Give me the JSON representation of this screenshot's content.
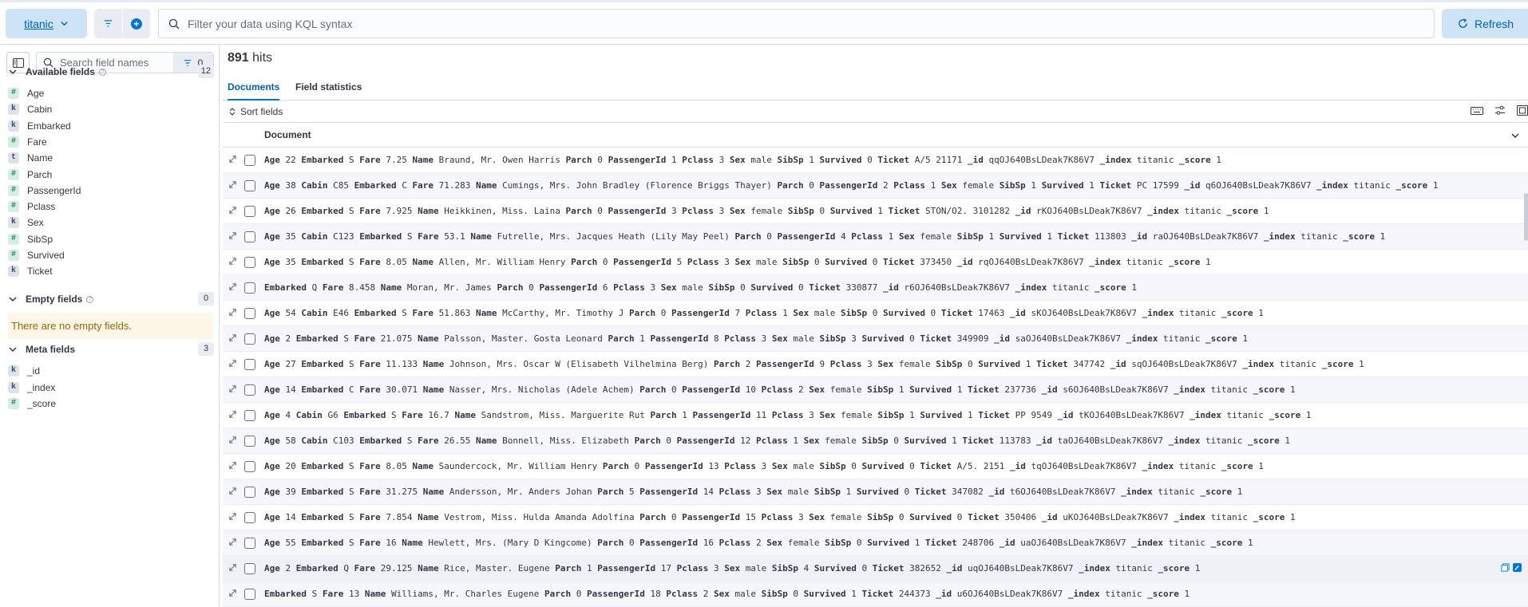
{
  "topbar": {
    "data_view": "titanic",
    "search_placeholder": "Filter your data using KQL syntax",
    "refresh_label": "Refresh"
  },
  "sidebar": {
    "search_placeholder": "Search field names",
    "filter_count": "0",
    "available": {
      "title": "Available fields",
      "count": "12",
      "fields": [
        {
          "name": "Age",
          "type": "#"
        },
        {
          "name": "Cabin",
          "type": "k"
        },
        {
          "name": "Embarked",
          "type": "k"
        },
        {
          "name": "Fare",
          "type": "#"
        },
        {
          "name": "Name",
          "type": "t"
        },
        {
          "name": "Parch",
          "type": "#"
        },
        {
          "name": "PassengerId",
          "type": "#"
        },
        {
          "name": "Pclass",
          "type": "#"
        },
        {
          "name": "Sex",
          "type": "k"
        },
        {
          "name": "SibSp",
          "type": "#"
        },
        {
          "name": "Survived",
          "type": "#"
        },
        {
          "name": "Ticket",
          "type": "k"
        }
      ]
    },
    "empty": {
      "title": "Empty fields",
      "count": "0",
      "message": "There are no empty fields."
    },
    "meta": {
      "title": "Meta fields",
      "count": "3",
      "fields": [
        {
          "name": "_id",
          "type": "k"
        },
        {
          "name": "_index",
          "type": "k"
        },
        {
          "name": "_score",
          "type": "#"
        }
      ]
    }
  },
  "main": {
    "hits_count": "891",
    "hits_label": "hits",
    "tabs": [
      "Documents",
      "Field statistics"
    ],
    "sort_label": "Sort fields",
    "column_header": "Document",
    "rows": [
      [
        [
          "Age",
          "22"
        ],
        [
          "Embarked",
          "S"
        ],
        [
          "Fare",
          "7.25"
        ],
        [
          "Name",
          "Braund, Mr. Owen Harris"
        ],
        [
          "Parch",
          "0"
        ],
        [
          "PassengerId",
          "1"
        ],
        [
          "Pclass",
          "3"
        ],
        [
          "Sex",
          "male"
        ],
        [
          "SibSp",
          "1"
        ],
        [
          "Survived",
          "0"
        ],
        [
          "Ticket",
          "A/5 21171"
        ],
        [
          "_id",
          "qqOJ640BsLDeak7K86V7"
        ],
        [
          "_index",
          "titanic"
        ],
        [
          "_score",
          "1"
        ]
      ],
      [
        [
          "Age",
          "38"
        ],
        [
          "Cabin",
          "C85"
        ],
        [
          "Embarked",
          "C"
        ],
        [
          "Fare",
          "71.283"
        ],
        [
          "Name",
          "Cumings, Mrs. John Bradley (Florence Briggs Thayer)"
        ],
        [
          "Parch",
          "0"
        ],
        [
          "PassengerId",
          "2"
        ],
        [
          "Pclass",
          "1"
        ],
        [
          "Sex",
          "female"
        ],
        [
          "SibSp",
          "1"
        ],
        [
          "Survived",
          "1"
        ],
        [
          "Ticket",
          "PC 17599"
        ],
        [
          "_id",
          "q6OJ640BsLDeak7K86V7"
        ],
        [
          "_index",
          "titanic"
        ],
        [
          "_score",
          "1"
        ]
      ],
      [
        [
          "Age",
          "26"
        ],
        [
          "Embarked",
          "S"
        ],
        [
          "Fare",
          "7.925"
        ],
        [
          "Name",
          "Heikkinen, Miss. Laina"
        ],
        [
          "Parch",
          "0"
        ],
        [
          "PassengerId",
          "3"
        ],
        [
          "Pclass",
          "3"
        ],
        [
          "Sex",
          "female"
        ],
        [
          "SibSp",
          "0"
        ],
        [
          "Survived",
          "1"
        ],
        [
          "Ticket",
          "STON/O2. 3101282"
        ],
        [
          "_id",
          "rKOJ640BsLDeak7K86V7"
        ],
        [
          "_index",
          "titanic"
        ],
        [
          "_score",
          "1"
        ]
      ],
      [
        [
          "Age",
          "35"
        ],
        [
          "Cabin",
          "C123"
        ],
        [
          "Embarked",
          "S"
        ],
        [
          "Fare",
          "53.1"
        ],
        [
          "Name",
          "Futrelle, Mrs. Jacques Heath (Lily May Peel)"
        ],
        [
          "Parch",
          "0"
        ],
        [
          "PassengerId",
          "4"
        ],
        [
          "Pclass",
          "1"
        ],
        [
          "Sex",
          "female"
        ],
        [
          "SibSp",
          "1"
        ],
        [
          "Survived",
          "1"
        ],
        [
          "Ticket",
          "113803"
        ],
        [
          "_id",
          "raOJ640BsLDeak7K86V7"
        ],
        [
          "_index",
          "titanic"
        ],
        [
          "_score",
          "1"
        ]
      ],
      [
        [
          "Age",
          "35"
        ],
        [
          "Embarked",
          "S"
        ],
        [
          "Fare",
          "8.05"
        ],
        [
          "Name",
          "Allen, Mr. William Henry"
        ],
        [
          "Parch",
          "0"
        ],
        [
          "PassengerId",
          "5"
        ],
        [
          "Pclass",
          "3"
        ],
        [
          "Sex",
          "male"
        ],
        [
          "SibSp",
          "0"
        ],
        [
          "Survived",
          "0"
        ],
        [
          "Ticket",
          "373450"
        ],
        [
          "_id",
          "rqOJ640BsLDeak7K86V7"
        ],
        [
          "_index",
          "titanic"
        ],
        [
          "_score",
          "1"
        ]
      ],
      [
        [
          "Embarked",
          "Q"
        ],
        [
          "Fare",
          "8.458"
        ],
        [
          "Name",
          "Moran, Mr. James"
        ],
        [
          "Parch",
          "0"
        ],
        [
          "PassengerId",
          "6"
        ],
        [
          "Pclass",
          "3"
        ],
        [
          "Sex",
          "male"
        ],
        [
          "SibSp",
          "0"
        ],
        [
          "Survived",
          "0"
        ],
        [
          "Ticket",
          "330877"
        ],
        [
          "_id",
          "r6OJ640BsLDeak7K86V7"
        ],
        [
          "_index",
          "titanic"
        ],
        [
          "_score",
          "1"
        ]
      ],
      [
        [
          "Age",
          "54"
        ],
        [
          "Cabin",
          "E46"
        ],
        [
          "Embarked",
          "S"
        ],
        [
          "Fare",
          "51.863"
        ],
        [
          "Name",
          "McCarthy, Mr. Timothy J"
        ],
        [
          "Parch",
          "0"
        ],
        [
          "PassengerId",
          "7"
        ],
        [
          "Pclass",
          "1"
        ],
        [
          "Sex",
          "male"
        ],
        [
          "SibSp",
          "0"
        ],
        [
          "Survived",
          "0"
        ],
        [
          "Ticket",
          "17463"
        ],
        [
          "_id",
          "sKOJ640BsLDeak7K86V7"
        ],
        [
          "_index",
          "titanic"
        ],
        [
          "_score",
          "1"
        ]
      ],
      [
        [
          "Age",
          "2"
        ],
        [
          "Embarked",
          "S"
        ],
        [
          "Fare",
          "21.075"
        ],
        [
          "Name",
          "Palsson, Master. Gosta Leonard"
        ],
        [
          "Parch",
          "1"
        ],
        [
          "PassengerId",
          "8"
        ],
        [
          "Pclass",
          "3"
        ],
        [
          "Sex",
          "male"
        ],
        [
          "SibSp",
          "3"
        ],
        [
          "Survived",
          "0"
        ],
        [
          "Ticket",
          "349909"
        ],
        [
          "_id",
          "saOJ640BsLDeak7K86V7"
        ],
        [
          "_index",
          "titanic"
        ],
        [
          "_score",
          "1"
        ]
      ],
      [
        [
          "Age",
          "27"
        ],
        [
          "Embarked",
          "S"
        ],
        [
          "Fare",
          "11.133"
        ],
        [
          "Name",
          "Johnson, Mrs. Oscar W (Elisabeth Vilhelmina Berg)"
        ],
        [
          "Parch",
          "2"
        ],
        [
          "PassengerId",
          "9"
        ],
        [
          "Pclass",
          "3"
        ],
        [
          "Sex",
          "female"
        ],
        [
          "SibSp",
          "0"
        ],
        [
          "Survived",
          "1"
        ],
        [
          "Ticket",
          "347742"
        ],
        [
          "_id",
          "sqOJ640BsLDeak7K86V7"
        ],
        [
          "_index",
          "titanic"
        ],
        [
          "_score",
          "1"
        ]
      ],
      [
        [
          "Age",
          "14"
        ],
        [
          "Embarked",
          "C"
        ],
        [
          "Fare",
          "30.071"
        ],
        [
          "Name",
          "Nasser, Mrs. Nicholas (Adele Achem)"
        ],
        [
          "Parch",
          "0"
        ],
        [
          "PassengerId",
          "10"
        ],
        [
          "Pclass",
          "2"
        ],
        [
          "Sex",
          "female"
        ],
        [
          "SibSp",
          "1"
        ],
        [
          "Survived",
          "1"
        ],
        [
          "Ticket",
          "237736"
        ],
        [
          "_id",
          "s6OJ640BsLDeak7K86V7"
        ],
        [
          "_index",
          "titanic"
        ],
        [
          "_score",
          "1"
        ]
      ],
      [
        [
          "Age",
          "4"
        ],
        [
          "Cabin",
          "G6"
        ],
        [
          "Embarked",
          "S"
        ],
        [
          "Fare",
          "16.7"
        ],
        [
          "Name",
          "Sandstrom, Miss. Marguerite Rut"
        ],
        [
          "Parch",
          "1"
        ],
        [
          "PassengerId",
          "11"
        ],
        [
          "Pclass",
          "3"
        ],
        [
          "Sex",
          "female"
        ],
        [
          "SibSp",
          "1"
        ],
        [
          "Survived",
          "1"
        ],
        [
          "Ticket",
          "PP 9549"
        ],
        [
          "_id",
          "tKOJ640BsLDeak7K86V7"
        ],
        [
          "_index",
          "titanic"
        ],
        [
          "_score",
          "1"
        ]
      ],
      [
        [
          "Age",
          "58"
        ],
        [
          "Cabin",
          "C103"
        ],
        [
          "Embarked",
          "S"
        ],
        [
          "Fare",
          "26.55"
        ],
        [
          "Name",
          "Bonnell, Miss. Elizabeth"
        ],
        [
          "Parch",
          "0"
        ],
        [
          "PassengerId",
          "12"
        ],
        [
          "Pclass",
          "1"
        ],
        [
          "Sex",
          "female"
        ],
        [
          "SibSp",
          "0"
        ],
        [
          "Survived",
          "1"
        ],
        [
          "Ticket",
          "113783"
        ],
        [
          "_id",
          "taOJ640BsLDeak7K86V7"
        ],
        [
          "_index",
          "titanic"
        ],
        [
          "_score",
          "1"
        ]
      ],
      [
        [
          "Age",
          "20"
        ],
        [
          "Embarked",
          "S"
        ],
        [
          "Fare",
          "8.05"
        ],
        [
          "Name",
          "Saundercock, Mr. William Henry"
        ],
        [
          "Parch",
          "0"
        ],
        [
          "PassengerId",
          "13"
        ],
        [
          "Pclass",
          "3"
        ],
        [
          "Sex",
          "male"
        ],
        [
          "SibSp",
          "0"
        ],
        [
          "Survived",
          "0"
        ],
        [
          "Ticket",
          "A/5. 2151"
        ],
        [
          "_id",
          "tqOJ640BsLDeak7K86V7"
        ],
        [
          "_index",
          "titanic"
        ],
        [
          "_score",
          "1"
        ]
      ],
      [
        [
          "Age",
          "39"
        ],
        [
          "Embarked",
          "S"
        ],
        [
          "Fare",
          "31.275"
        ],
        [
          "Name",
          "Andersson, Mr. Anders Johan"
        ],
        [
          "Parch",
          "5"
        ],
        [
          "PassengerId",
          "14"
        ],
        [
          "Pclass",
          "3"
        ],
        [
          "Sex",
          "male"
        ],
        [
          "SibSp",
          "1"
        ],
        [
          "Survived",
          "0"
        ],
        [
          "Ticket",
          "347082"
        ],
        [
          "_id",
          "t6OJ640BsLDeak7K86V7"
        ],
        [
          "_index",
          "titanic"
        ],
        [
          "_score",
          "1"
        ]
      ],
      [
        [
          "Age",
          "14"
        ],
        [
          "Embarked",
          "S"
        ],
        [
          "Fare",
          "7.854"
        ],
        [
          "Name",
          "Vestrom, Miss. Hulda Amanda Adolfina"
        ],
        [
          "Parch",
          "0"
        ],
        [
          "PassengerId",
          "15"
        ],
        [
          "Pclass",
          "3"
        ],
        [
          "Sex",
          "female"
        ],
        [
          "SibSp",
          "0"
        ],
        [
          "Survived",
          "0"
        ],
        [
          "Ticket",
          "350406"
        ],
        [
          "_id",
          "uKOJ640BsLDeak7K86V7"
        ],
        [
          "_index",
          "titanic"
        ],
        [
          "_score",
          "1"
        ]
      ],
      [
        [
          "Age",
          "55"
        ],
        [
          "Embarked",
          "S"
        ],
        [
          "Fare",
          "16"
        ],
        [
          "Name",
          "Hewlett, Mrs. (Mary D Kingcome) "
        ],
        [
          "Parch",
          "0"
        ],
        [
          "PassengerId",
          "16"
        ],
        [
          "Pclass",
          "2"
        ],
        [
          "Sex",
          "female"
        ],
        [
          "SibSp",
          "0"
        ],
        [
          "Survived",
          "1"
        ],
        [
          "Ticket",
          "248706"
        ],
        [
          "_id",
          "uaOJ640BsLDeak7K86V7"
        ],
        [
          "_index",
          "titanic"
        ],
        [
          "_score",
          "1"
        ]
      ],
      [
        [
          "Age",
          "2"
        ],
        [
          "Embarked",
          "Q"
        ],
        [
          "Fare",
          "29.125"
        ],
        [
          "Name",
          "Rice, Master. Eugene"
        ],
        [
          "Parch",
          "1"
        ],
        [
          "PassengerId",
          "17"
        ],
        [
          "Pclass",
          "3"
        ],
        [
          "Sex",
          "male"
        ],
        [
          "SibSp",
          "4"
        ],
        [
          "Survived",
          "0"
        ],
        [
          "Ticket",
          "382652"
        ],
        [
          "_id",
          "uqOJ640BsLDeak7K86V7"
        ],
        [
          "_index",
          "titanic"
        ],
        [
          "_score",
          "1"
        ]
      ],
      [
        [
          "Embarked",
          "S"
        ],
        [
          "Fare",
          "13"
        ],
        [
          "Name",
          "Williams, Mr. Charles Eugene"
        ],
        [
          "Parch",
          "0"
        ],
        [
          "PassengerId",
          "18"
        ],
        [
          "Pclass",
          "2"
        ],
        [
          "Sex",
          "male"
        ],
        [
          "SibSp",
          "0"
        ],
        [
          "Survived",
          "1"
        ],
        [
          "Ticket",
          "244373"
        ],
        [
          "_id",
          "u6OJ640BsLDeak7K86V7"
        ],
        [
          "_index",
          "titanic"
        ],
        [
          "_score",
          "1"
        ]
      ]
    ]
  }
}
